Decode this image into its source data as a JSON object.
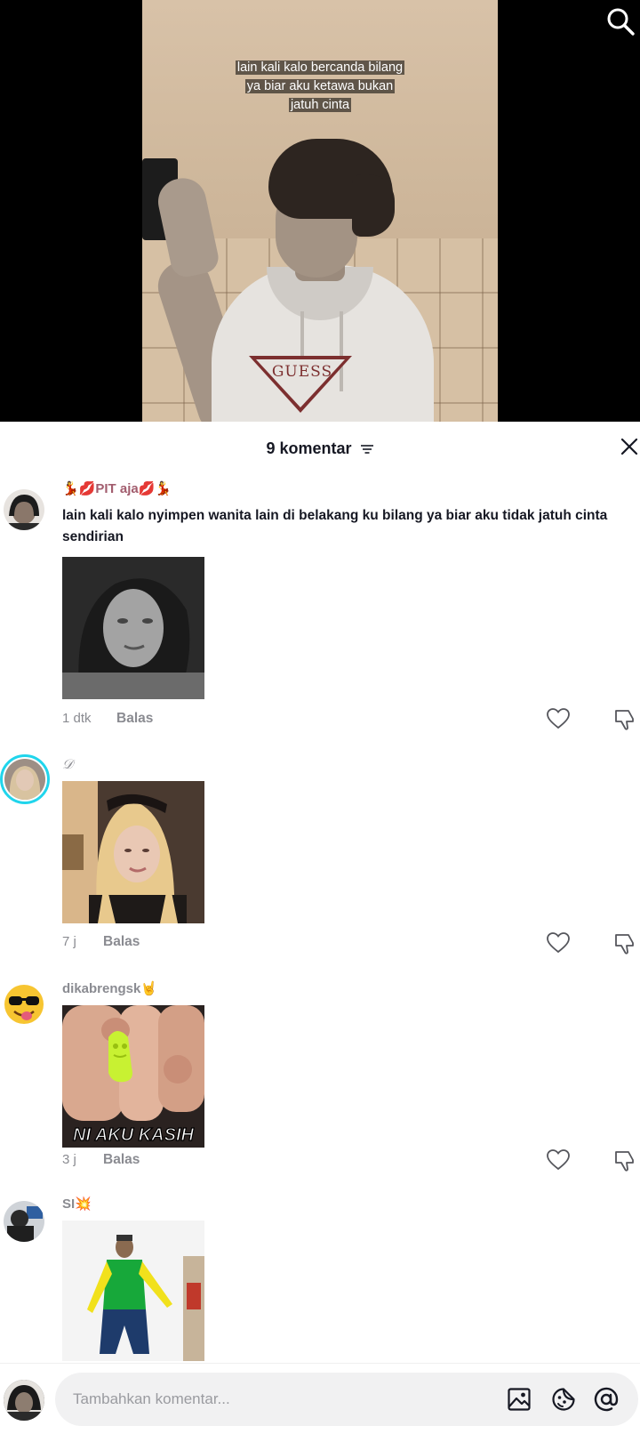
{
  "video": {
    "caption_line1": "lain kali kalo bercanda bilang",
    "caption_line2": "ya biar aku ketawa bukan",
    "caption_line3": "jatuh cinta",
    "shirt_logo": "GUESS"
  },
  "header": {
    "title": "9 komentar"
  },
  "comments": [
    {
      "username": "💃💋PIT aja💋💃",
      "text": "lain kali kalo nyimpen wanita lain di belakang ku bilang ya biar aku tidak jatuh cinta sendirian",
      "time": "1 dtk",
      "reply": "Balas"
    },
    {
      "username": "𝒟",
      "time": "7 j",
      "reply": "Balas"
    },
    {
      "username": "dikabrengsk🤘",
      "gif_text": "NI AKU KASIH",
      "time": "3 j",
      "reply": "Balas"
    },
    {
      "username": "SI💥"
    }
  ],
  "input": {
    "placeholder": "Tambahkan komentar..."
  },
  "colors": {
    "accent_ring": "#20d5ec",
    "muted_text": "#8a8b91",
    "primary_text": "#161823"
  }
}
